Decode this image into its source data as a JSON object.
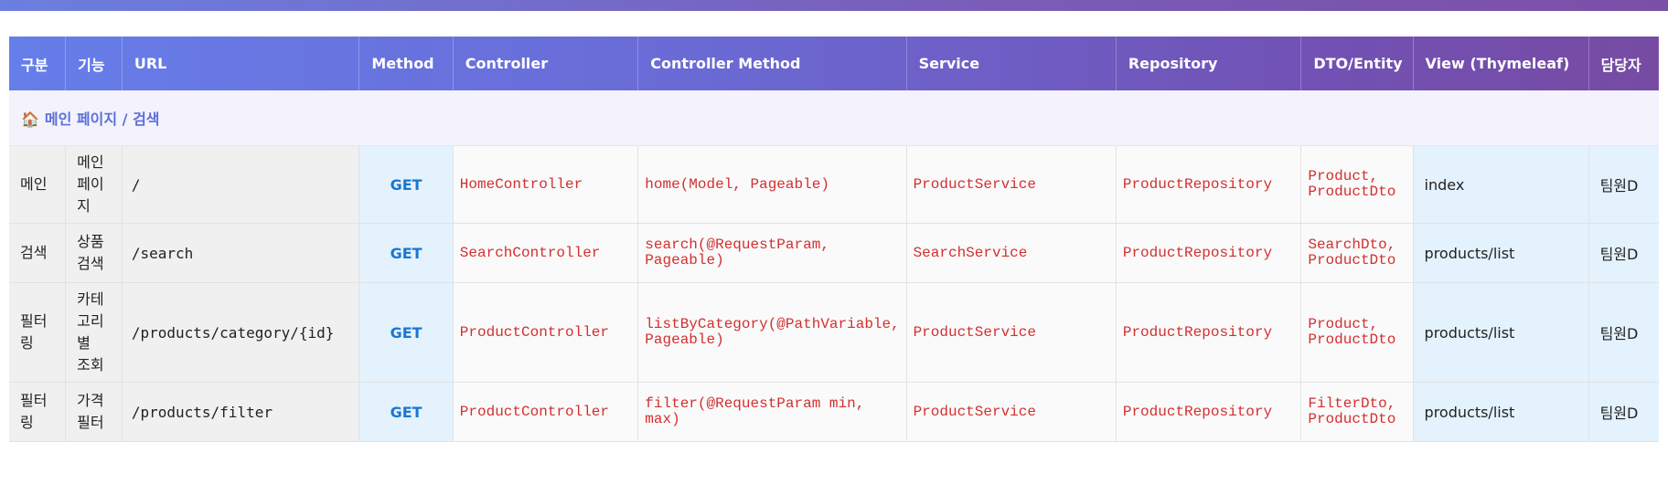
{
  "table": {
    "headers": [
      "구분",
      "기능",
      "URL",
      "Method",
      "Controller",
      "Controller Method",
      "Service",
      "Repository",
      "DTO/Entity",
      "View (Thymeleaf)",
      "담당자"
    ],
    "section": {
      "icon": "house-icon",
      "glyph": "🏠",
      "label": "메인 페이지 / 검색"
    },
    "rows": [
      {
        "category": "메인",
        "feature": "메인\n페이\n지",
        "url": "/",
        "method": "GET",
        "controller": "HomeController",
        "controller_method": "home(Model, Pageable)",
        "service": "ProductService",
        "repository": "ProductRepository",
        "dto": "Product,\nProductDto",
        "view": "index",
        "owner": "팀원D"
      },
      {
        "category": "검색",
        "feature": "상품\n검색",
        "url": "/search",
        "method": "GET",
        "controller": "SearchController",
        "controller_method": "search(@RequestParam, Pageable)",
        "service": "SearchService",
        "repository": "ProductRepository",
        "dto": "SearchDto,\nProductDto",
        "view": "products/list",
        "owner": "팀원D"
      },
      {
        "category": "필터\n링",
        "feature": "카테\n고리\n별\n조회",
        "url": "/products/category/{id}",
        "method": "GET",
        "controller": "ProductController",
        "controller_method": "listByCategory(@PathVariable,\nPageable)",
        "service": "ProductService",
        "repository": "ProductRepository",
        "dto": "Product,\nProductDto",
        "view": "products/list",
        "owner": "팀원D"
      },
      {
        "category": "필터\n링",
        "feature": "가격\n필터",
        "url": "/products/filter",
        "method": "GET",
        "controller": "ProductController",
        "controller_method": "filter(@RequestParam min, max)",
        "service": "ProductService",
        "repository": "ProductRepository",
        "dto": "FilterDto,\nProductDto",
        "view": "products/list",
        "owner": "팀원D"
      }
    ]
  },
  "colors": {
    "header_gradient_start": "#667eea",
    "header_gradient_end": "#764ba2",
    "method_color": "#1976d2",
    "code_color": "#d32f2f",
    "section_color": "#5b6fd9"
  }
}
